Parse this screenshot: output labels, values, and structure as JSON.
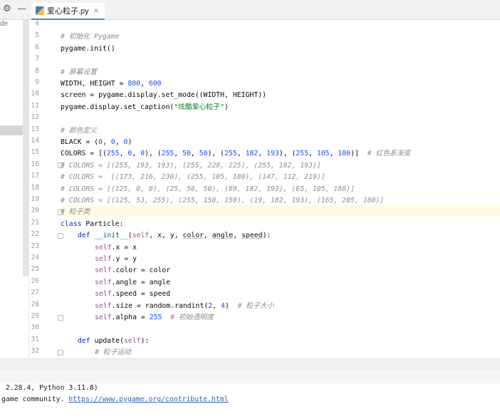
{
  "tab": {
    "label": "爱心粒子.py",
    "close": "×"
  },
  "left_pane": {
    "text": "de"
  },
  "gutter": {
    "numbers": [
      "4",
      "5",
      "6",
      "7",
      "8",
      "9",
      "10",
      "11",
      "12",
      "13",
      "14",
      "15",
      "16",
      "17",
      "18",
      "19",
      "20",
      "21",
      "22",
      "23",
      "24",
      "25",
      "26",
      "27",
      "28",
      "29",
      "30",
      "31",
      "32"
    ]
  },
  "code": {
    "l5": "# 初始化 Pygame",
    "l6": "pygame.init()",
    "l8": "# 屏幕设置",
    "l9a": "WIDTH, HEIGHT = ",
    "l9b": "800",
    "l9c": ", ",
    "l9d": "600",
    "l10": "screen = pygame.display.set_mode((WIDTH, HEIGHT))",
    "l11a": "pygame.display.set_caption(",
    "l11b": "\"炫酷爱心粒子\"",
    "l11c": ")",
    "l13": "# 颜色定义",
    "l14a": "BLACK = (",
    "l14b": "0",
    "l14c": ", ",
    "l14d": "0",
    "l14e": ", ",
    "l14f": "0",
    "l14g": ")",
    "l15a": "COLORS = [(",
    "l15b": "255",
    "l15c": ", ",
    "l15d": "0",
    "l15e": ", ",
    "l15f": "0",
    "l15g": "), (",
    "l15h": "255",
    "l15i": ", ",
    "l15j": "50",
    "l15k": ", ",
    "l15l": "50",
    "l15m": "), (",
    "l15n": "255",
    "l15o": ", ",
    "l15p": "182",
    "l15q": ", ",
    "l15r": "193",
    "l15s": "), (",
    "l15t": "255",
    "l15u": ", ",
    "l15v": "105",
    "l15w": ", ",
    "l15x": "180",
    "l15y": ")]  ",
    "l15z": "# 红色系渐变",
    "l16": "# COLORS = [(255, 193, 193), (255, 228, 225), (255, 182, 193)]",
    "l17": "# COLORS =  [(173, 216, 230), (255, 105, 180), (147, 112, 219)]",
    "l18": "# COLORS = [(125, 0, 0), (25, 50, 50), (89, 182, 193), (65, 105, 180)]",
    "l19": "# COLORS = [(125, 53, 255), (255, 150, 150), (19, 182, 193), (165, 205, 180)]",
    "l20": "# 粒子类",
    "l21a": "class",
    "l21b": " Particle:",
    "l22a": "def",
    "l22b": "__init__",
    "l22c": "(",
    "l22d": "self",
    "l22e": ", x, y, ",
    "l22f": "color",
    "l22g": ", ",
    "l22h": "angle",
    "l22i": ", ",
    "l22j": "speed",
    "l22k": "):",
    "self_kw": "self",
    "l23": ".x = x",
    "l24": ".y = y",
    "l25": ".color = color",
    "l26": ".angle = angle",
    "l27": ".speed = speed",
    "l28a": ".size = random.randint(",
    "l28b": "2",
    "l28c": ", ",
    "l28d": "4",
    "l28e": ")  ",
    "l28f": "# 粒子大小",
    "l29a": ".alpha = ",
    "l29b": "255",
    "l29c": "  ",
    "l29d": "# 初始透明度",
    "l31a": "def",
    "l31b": " update(",
    "l31c": "self",
    "l31d": "):",
    "l32": "# 粒子运动"
  },
  "console": {
    "line1": " 2.28.4, Python 3.11.8)",
    "line2a": "game community. ",
    "line2b": "https://www.pygame.org/contribute.html"
  },
  "colors": {
    "tab_underline": "#4a88c7",
    "current_line": "#fffae3",
    "keyword": "#0033b3",
    "number": "#1750eb",
    "string": "#067d17",
    "comment": "#8c8c8c",
    "self": "#94558d"
  }
}
